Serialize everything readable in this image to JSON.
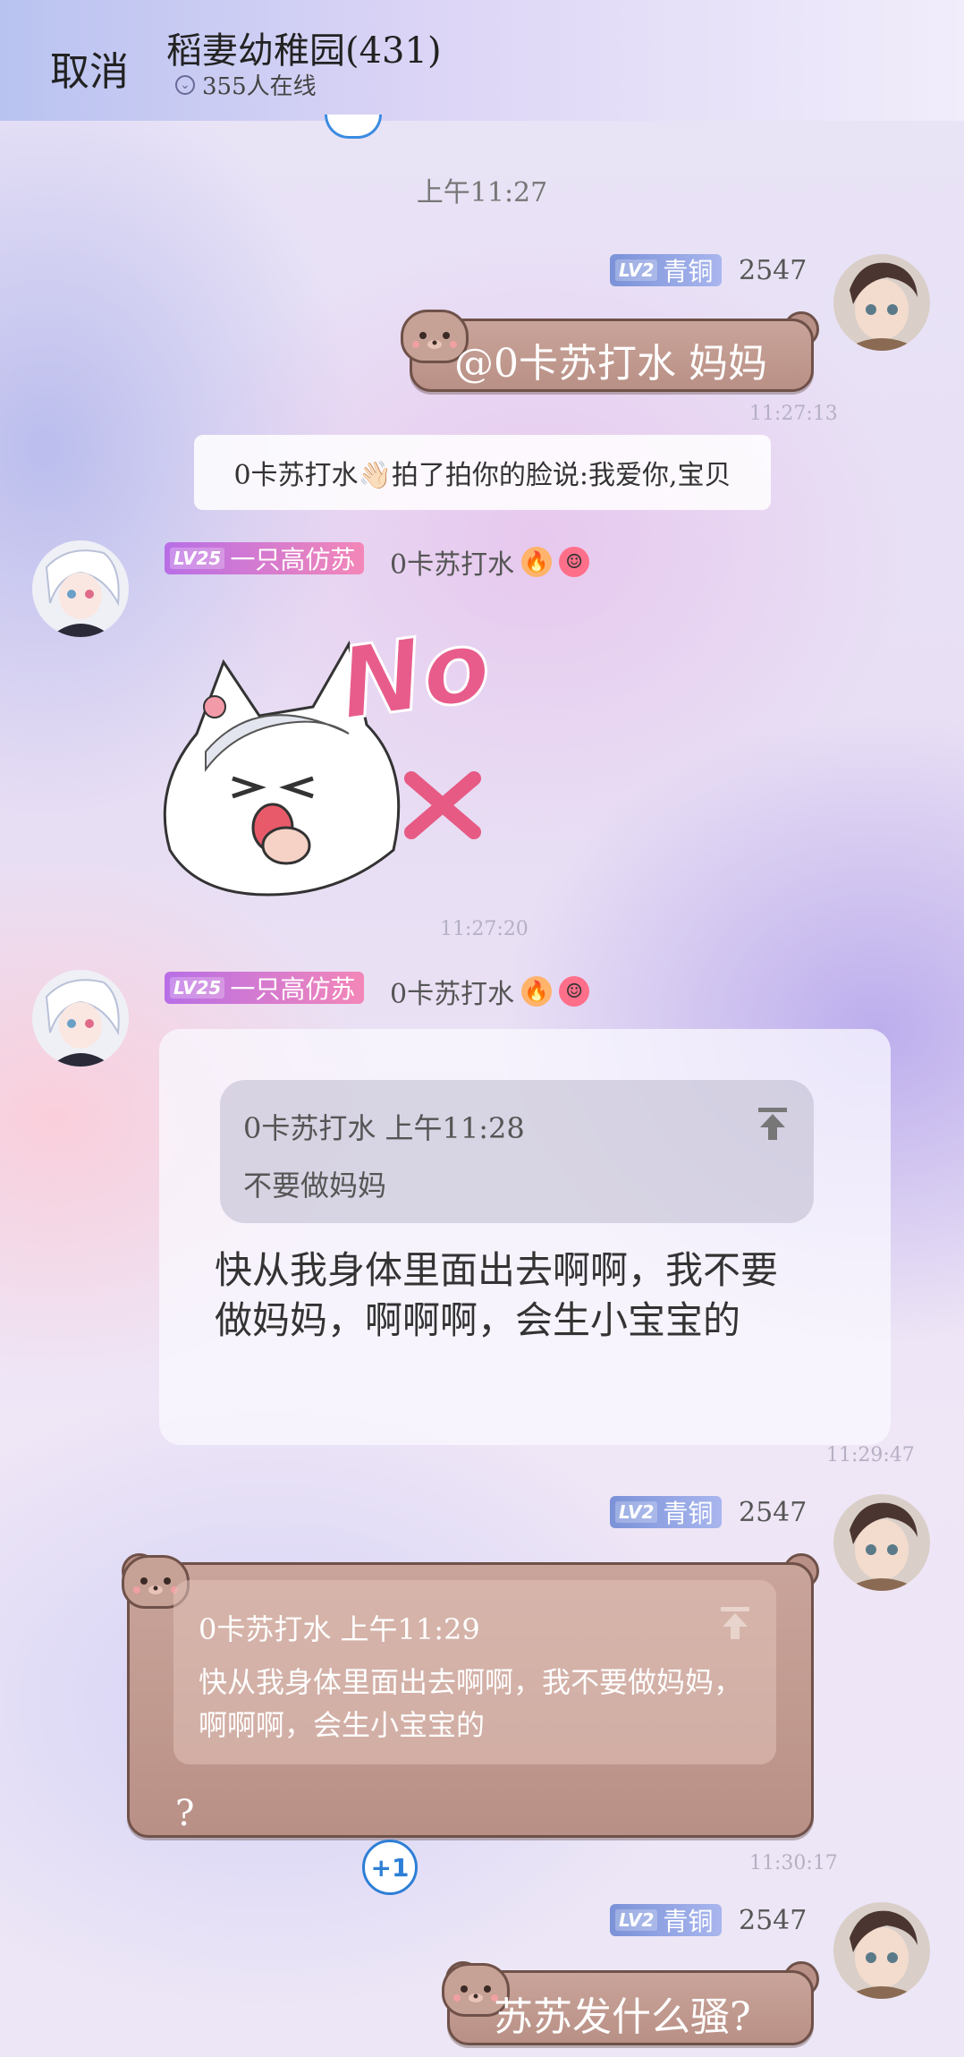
{
  "header": {
    "cancel_label": "取消",
    "group_title": "稻妻幼稚园(431)",
    "online_text": "355人在线"
  },
  "colors": {
    "badge_blue": "#8ca0e0",
    "badge_pink": "#d37bd0",
    "bubble_brown": "#c09a90",
    "plus_one_blue": "#2d7fd6"
  },
  "messages": [
    {
      "time": "上午11:27",
      "badge_level": "LV2",
      "badge_title": "青铜",
      "points": "2547",
      "text": "@0卡苏打水  妈妈",
      "sent_time": "11:27:13"
    },
    {
      "system_text": "0卡苏打水👋🏻拍了拍你的脸说:我爱你,宝贝"
    },
    {
      "badge_level": "LV25",
      "badge_title": "一只高仿苏",
      "nickname": "0卡苏打水",
      "sticker_text": "No",
      "sent_time": "11:27:20"
    },
    {
      "badge_level": "LV25",
      "badge_title": "一只高仿苏",
      "nickname": "0卡苏打水",
      "quote_author_time": "0卡苏打水  上午11:28",
      "quote_text": "不要做妈妈",
      "text": "快从我身体里面出去啊啊，我不要做妈妈，啊啊啊，会生小宝宝的",
      "sent_time": "11:29:47"
    },
    {
      "badge_level": "LV2",
      "badge_title": "青铜",
      "points": "2547",
      "quote_author_time": "0卡苏打水  上午11:29",
      "quote_text": "快从我身体里面出去啊啊，我不要做妈妈，啊啊啊，会生小宝宝的",
      "text": "?",
      "reaction": "+1",
      "sent_time": "11:30:17"
    },
    {
      "badge_level": "LV2",
      "badge_title": "青铜",
      "points": "2547",
      "text": "苏苏发什么骚?"
    }
  ]
}
